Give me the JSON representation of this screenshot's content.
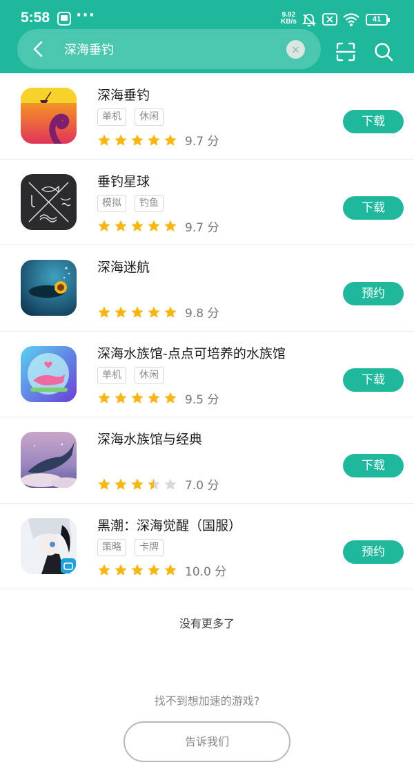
{
  "status_bar": {
    "time": "5:58",
    "net_speed_value": "9.92",
    "net_speed_unit": "KB/s",
    "battery": "41",
    "icons": [
      "app-notification-icon",
      "more-dots-icon",
      "mute-bell-icon",
      "no-sim-icon",
      "wifi-icon",
      "battery-icon"
    ]
  },
  "search": {
    "value": "深海垂钓",
    "clear": "×",
    "icons": [
      "back-icon",
      "clear-icon",
      "scan-icon",
      "search-icon"
    ]
  },
  "colors": {
    "brand": "#1fb89c",
    "star": "#f7b614",
    "star_empty": "#d9d9d9"
  },
  "results": [
    {
      "name": "深海垂钓",
      "tags": [
        "单机",
        "休闲"
      ],
      "score": "9.7 分",
      "rating": 5,
      "action": "下载"
    },
    {
      "name": "垂钓星球",
      "tags": [
        "模拟",
        "钓鱼"
      ],
      "score": "9.7 分",
      "rating": 5,
      "action": "下载"
    },
    {
      "name": "深海迷航",
      "tags": [],
      "score": "9.8 分",
      "rating": 5,
      "action": "预约"
    },
    {
      "name": "深海水族馆-点点可培养的水族馆",
      "tags": [
        "单机",
        "休闲"
      ],
      "score": "9.5 分",
      "rating": 5,
      "action": "下载"
    },
    {
      "name": "深海水族馆与经典",
      "tags": [],
      "score": "7.0 分",
      "rating": 3.5,
      "action": "下载"
    },
    {
      "name": "黑潮：深海觉醒（国服）",
      "tags": [
        "策略",
        "卡牌"
      ],
      "score": "10.0 分",
      "rating": 5,
      "action": "预约"
    }
  ],
  "footer": {
    "no_more": "没有更多了",
    "hint": "找不到想加速的游戏?",
    "tell_us": "告诉我们"
  }
}
